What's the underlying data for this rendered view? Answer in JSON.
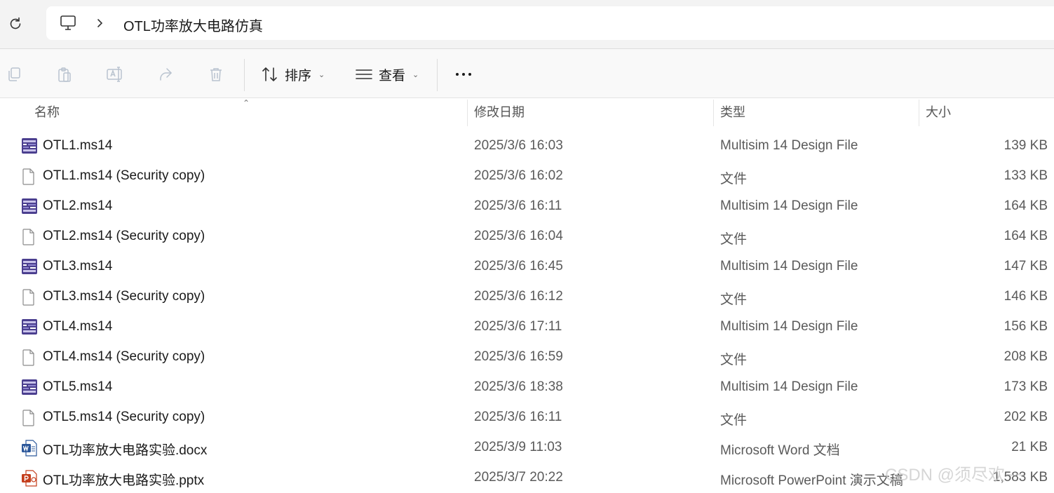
{
  "address": {
    "breadcrumb": "OTL功率放大电路仿真",
    "icons": {
      "refresh": "refresh-icon",
      "location": "this-pc-icon",
      "separator": "chevron-right-icon"
    }
  },
  "toolbar": {
    "icons": [
      "copy-icon",
      "paste-icon",
      "rename-icon",
      "share-icon",
      "delete-icon"
    ],
    "sort_label": "排序",
    "view_label": "查看",
    "more_icon": "more-icon"
  },
  "columns": {
    "name": "名称",
    "modified": "修改日期",
    "type": "类型",
    "size": "大小"
  },
  "files": [
    {
      "name": "OTL1.ms14",
      "date": "2025/3/6 16:03",
      "type": "Multisim 14 Design File",
      "size": "139 KB",
      "icon": "multisim"
    },
    {
      "name": "OTL1.ms14 (Security copy)",
      "date": "2025/3/6 16:02",
      "type": "文件",
      "size": "133 KB",
      "icon": "file"
    },
    {
      "name": "OTL2.ms14",
      "date": "2025/3/6 16:11",
      "type": "Multisim 14 Design File",
      "size": "164 KB",
      "icon": "multisim"
    },
    {
      "name": "OTL2.ms14 (Security copy)",
      "date": "2025/3/6 16:04",
      "type": "文件",
      "size": "164 KB",
      "icon": "file"
    },
    {
      "name": "OTL3.ms14",
      "date": "2025/3/6 16:45",
      "type": "Multisim 14 Design File",
      "size": "147 KB",
      "icon": "multisim"
    },
    {
      "name": "OTL3.ms14 (Security copy)",
      "date": "2025/3/6 16:12",
      "type": "文件",
      "size": "146 KB",
      "icon": "file"
    },
    {
      "name": "OTL4.ms14",
      "date": "2025/3/6 17:11",
      "type": "Multisim 14 Design File",
      "size": "156 KB",
      "icon": "multisim"
    },
    {
      "name": "OTL4.ms14 (Security copy)",
      "date": "2025/3/6 16:59",
      "type": "文件",
      "size": "208 KB",
      "icon": "file"
    },
    {
      "name": "OTL5.ms14",
      "date": "2025/3/6 18:38",
      "type": "Multisim 14 Design File",
      "size": "173 KB",
      "icon": "multisim"
    },
    {
      "name": "OTL5.ms14 (Security copy)",
      "date": "2025/3/6 16:11",
      "type": "文件",
      "size": "202 KB",
      "icon": "file"
    },
    {
      "name": "OTL功率放大电路实验.docx",
      "date": "2025/3/9 11:03",
      "type": "Microsoft Word 文档",
      "size": "21 KB",
      "icon": "word"
    },
    {
      "name": "OTL功率放大电路实验.pptx",
      "date": "2025/3/7 20:22",
      "type": "Microsoft PowerPoint 演示文稿",
      "size": "1,583 KB",
      "icon": "powerpoint"
    }
  ],
  "watermark": "CSDN @须尽欢~~",
  "colors": {
    "toolbar_bg": "#f9f9f9",
    "topbar_bg": "#f3f3f3",
    "word_blue": "#2b579a",
    "ppt_red": "#c43e1c",
    "multisim_purple": "#4b3f8f"
  }
}
